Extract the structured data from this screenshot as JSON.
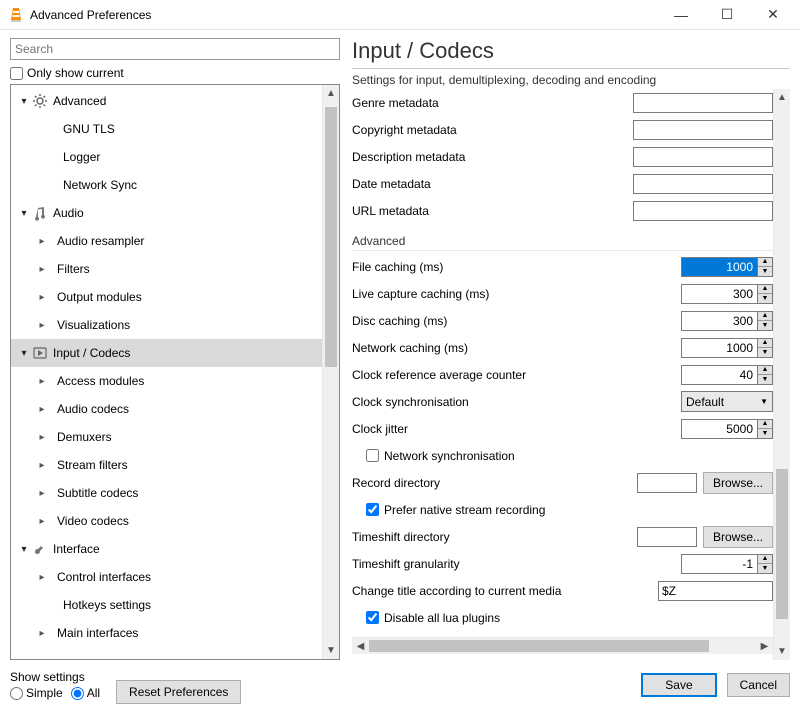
{
  "window": {
    "title": "Advanced Preferences"
  },
  "search": {
    "placeholder": "Search"
  },
  "only_show_label": "Only show current",
  "tree": {
    "advanced": {
      "label": "Advanced",
      "children": {
        "gnutls": "GNU TLS",
        "logger": "Logger",
        "netsync": "Network Sync"
      }
    },
    "audio": {
      "label": "Audio",
      "children": {
        "resampler": "Audio resampler",
        "filters": "Filters",
        "output_modules": "Output modules",
        "visualizations": "Visualizations"
      }
    },
    "input_codecs": {
      "label": "Input / Codecs",
      "children": {
        "access_modules": "Access modules",
        "audio_codecs": "Audio codecs",
        "demuxers": "Demuxers",
        "stream_filters": "Stream filters",
        "subtitle_codecs": "Subtitle codecs",
        "video_codecs": "Video codecs"
      }
    },
    "interface": {
      "label": "Interface",
      "children": {
        "control_interfaces": "Control interfaces",
        "hotkeys": "Hotkeys settings",
        "main_interfaces": "Main interfaces"
      }
    }
  },
  "panel": {
    "title": "Input / Codecs",
    "desc": "Settings for input, demultiplexing, decoding and encoding",
    "meta": {
      "genre": "Genre metadata",
      "copyright": "Copyright metadata",
      "description": "Description metadata",
      "date": "Date metadata",
      "url": "URL metadata"
    },
    "advanced_hdr": "Advanced",
    "file_caching_label": "File caching (ms)",
    "file_caching_value": "1000",
    "live_caching_label": "Live capture caching (ms)",
    "live_caching_value": "300",
    "disc_caching_label": "Disc caching (ms)",
    "disc_caching_value": "300",
    "network_caching_label": "Network caching (ms)",
    "network_caching_value": "1000",
    "clock_ref_label": "Clock reference average counter",
    "clock_ref_value": "40",
    "clock_sync_label": "Clock synchronisation",
    "clock_sync_value": "Default",
    "clock_jitter_label": "Clock jitter",
    "clock_jitter_value": "5000",
    "network_sync_label": "Network synchronisation",
    "record_dir_label": "Record directory",
    "browse_label": "Browse...",
    "prefer_native_label": "Prefer native stream recording",
    "timeshift_dir_label": "Timeshift directory",
    "timeshift_gran_label": "Timeshift granularity",
    "timeshift_gran_value": "-1",
    "change_title_label": "Change title according to current media",
    "change_title_value": "$Z",
    "disable_lua_label": "Disable all lua plugins"
  },
  "footer": {
    "show_settings": "Show settings",
    "simple": "Simple",
    "all": "All",
    "reset": "Reset Preferences",
    "save": "Save",
    "cancel": "Cancel"
  }
}
